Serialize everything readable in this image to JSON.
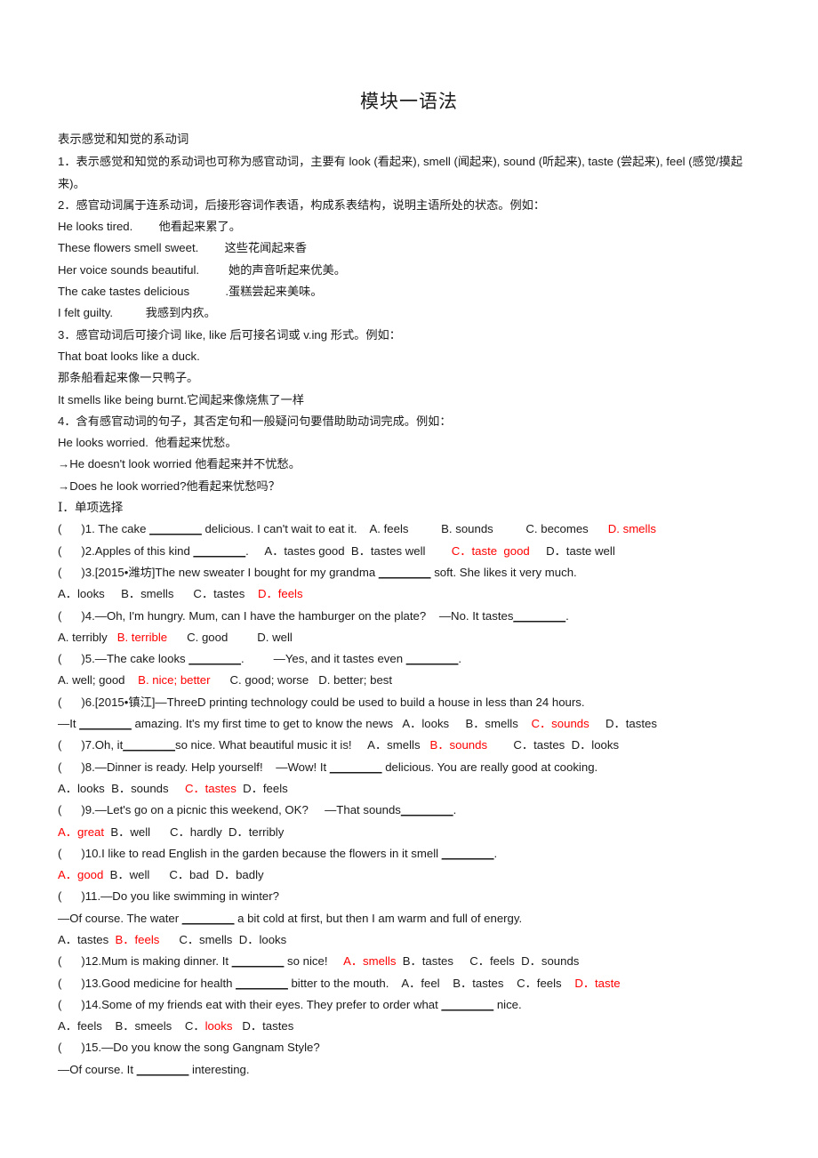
{
  "document": {
    "title": "模块一语法",
    "accent_color": "#ff0000",
    "text_color": "#1a1a1a",
    "background": "#ffffff"
  },
  "grammar": {
    "heading": "表示感觉和知觉的系动词",
    "point1": "1．表示感觉和知觉的系动词也可称为感官动词，主要有 look (看起来), smell (闻起来), sound (听起来), taste (尝起来), feel (感觉/摸起来)。",
    "point2": "2．感官动词属于连系动词，后接形容词作表语，构成系表结构，说明主语所处的状态。例如：",
    "examples2": [
      "He looks tired.        他看起来累了。",
      "These flowers smell sweet.        这些花闻起来香",
      "Her voice sounds beautiful.         她的声音听起来优美。",
      "The cake tastes delicious           .蛋糕尝起来美味。",
      "I felt guilty.          我感到内疚。"
    ],
    "point3": "3．感官动词后可接介词 like, like 后可接名词或 v.ing 形式。例如：",
    "examples3": [
      "That boat looks like a duck.",
      "那条船看起来像一只鸭子。",
      "It smells like being burnt.它闻起来像烧焦了一样"
    ],
    "point4": "4．含有感官动词的句子，其否定句和一般疑问句要借助助动词完成。例如：",
    "examples4": [
      "He looks worried.  他看起来忧愁。",
      "→He doesn't look worried 他看起来并不忧愁。",
      "→Does he look worried?他看起来忧愁吗？"
    ]
  },
  "section1": {
    "heading": "Ⅰ．单项选择",
    "questions": [
      {
        "id": "q1",
        "lines": [
          [
            {
              "t": "(      )1. The cake ",
              "red": false
            },
            {
              "t": "________",
              "red": false,
              "blank": true
            },
            {
              "t": " delicious. I can't wait to eat it.    A. feels          B. sounds          C. becomes      ",
              "red": false
            },
            {
              "t": "D. smells",
              "red": true
            }
          ]
        ]
      },
      {
        "id": "q2",
        "lines": [
          [
            {
              "t": "(      )2.Apples of this kind ",
              "red": false
            },
            {
              "t": "________",
              "red": false,
              "blank": true
            },
            {
              "t": ".     A．tastes good  B．tastes well        ",
              "red": false
            },
            {
              "t": "C．taste  good",
              "red": true
            },
            {
              "t": "     D．taste well",
              "red": false
            }
          ]
        ]
      },
      {
        "id": "q3",
        "lines": [
          [
            {
              "t": "(      )3.[2015•潍坊]The new sweater I bought for my grandma ",
              "red": false
            },
            {
              "t": "________",
              "red": false,
              "blank": true
            },
            {
              "t": " soft. She likes it very much.",
              "red": false
            }
          ],
          [
            {
              "t": "A．looks     B．smells      C．tastes    ",
              "red": false
            },
            {
              "t": "D．feels",
              "red": true
            }
          ]
        ]
      },
      {
        "id": "q4",
        "lines": [
          [
            {
              "t": "(      )4.—Oh, I'm hungry. Mum, can I have the hamburger on the plate?    —No. It tastes",
              "red": false
            },
            {
              "t": "________",
              "red": false,
              "blank": true
            },
            {
              "t": ".",
              "red": false
            }
          ],
          [
            {
              "t": "A. terribly   ",
              "red": false
            },
            {
              "t": "B. terrible",
              "red": true
            },
            {
              "t": "      C. good         D. well",
              "red": false
            }
          ]
        ]
      },
      {
        "id": "q5",
        "lines": [
          [
            {
              "t": "(      )5.—The cake looks ",
              "red": false
            },
            {
              "t": "________",
              "red": false,
              "blank": true
            },
            {
              "t": ".         —Yes, and it tastes even ",
              "red": false
            },
            {
              "t": "________",
              "red": false,
              "blank": true
            },
            {
              "t": ".",
              "red": false
            }
          ],
          [
            {
              "t": "A. well; good    ",
              "red": false
            },
            {
              "t": "B. nice; better",
              "red": true
            },
            {
              "t": "      C. good; worse   D. better; best",
              "red": false
            }
          ]
        ]
      },
      {
        "id": "q6",
        "lines": [
          [
            {
              "t": "(      )6.[2015•镇江]—ThreeD printing technology could be used to build a house in less than 24 hours.",
              "red": false
            }
          ],
          [
            {
              "t": "—It ",
              "red": false
            },
            {
              "t": "________",
              "red": false,
              "blank": true
            },
            {
              "t": " amazing. It's my first time to get to know the news   A．looks     B．smells    ",
              "red": false
            },
            {
              "t": "C．sounds",
              "red": true
            },
            {
              "t": "     D．tastes",
              "red": false
            }
          ]
        ]
      },
      {
        "id": "q7",
        "lines": [
          [
            {
              "t": "(      )7.Oh, it",
              "red": false
            },
            {
              "t": "________",
              "red": false,
              "blank": true
            },
            {
              "t": "so nice. What beautiful music it is!     A．smells   ",
              "red": false
            },
            {
              "t": "B．sounds",
              "red": true
            },
            {
              "t": "        C．tastes  D．looks",
              "red": false
            }
          ]
        ]
      },
      {
        "id": "q8",
        "lines": [
          [
            {
              "t": "(      )8.—Dinner is ready. Help yourself!    —Wow! It ",
              "red": false
            },
            {
              "t": "________",
              "red": false,
              "blank": true
            },
            {
              "t": " delicious. You are really good at cooking.",
              "red": false
            }
          ],
          [
            {
              "t": "A．looks  B．sounds     ",
              "red": false
            },
            {
              "t": "C．tastes",
              "red": true
            },
            {
              "t": "  D．feels",
              "red": false
            }
          ]
        ]
      },
      {
        "id": "q9",
        "lines": [
          [
            {
              "t": "(      )9.—Let's go on a picnic this weekend, OK?     —That sounds",
              "red": false
            },
            {
              "t": "________",
              "red": false,
              "blank": true
            },
            {
              "t": ".",
              "red": false
            }
          ],
          [
            {
              "t": "A．great",
              "red": true
            },
            {
              "t": "  B．well      C．hardly  D．terribly",
              "red": false
            }
          ]
        ]
      },
      {
        "id": "q10",
        "lines": [
          [
            {
              "t": "(      )10.I like to read English in the garden because the flowers in it smell ",
              "red": false
            },
            {
              "t": "________",
              "red": false,
              "blank": true
            },
            {
              "t": ".",
              "red": false
            }
          ],
          [
            {
              "t": "A．good",
              "red": true
            },
            {
              "t": "  B．well      C．bad  D．badly",
              "red": false
            }
          ]
        ]
      },
      {
        "id": "q11",
        "lines": [
          [
            {
              "t": "(      )11.—Do you like swimming in winter?",
              "red": false
            }
          ],
          [
            {
              "t": "—Of course. The water ",
              "red": false
            },
            {
              "t": "________",
              "red": false,
              "blank": true
            },
            {
              "t": " a bit cold at first, but then I am warm and full of energy.",
              "red": false
            }
          ],
          [
            {
              "t": "A．tastes  ",
              "red": false
            },
            {
              "t": "B．feels",
              "red": true
            },
            {
              "t": "      C．smells  D．looks",
              "red": false
            }
          ]
        ]
      },
      {
        "id": "q12",
        "lines": [
          [
            {
              "t": "(      )12.Mum is making dinner. It ",
              "red": false
            },
            {
              "t": "________",
              "red": false,
              "blank": true
            },
            {
              "t": " so nice!     ",
              "red": false
            },
            {
              "t": "A．smells",
              "red": true
            },
            {
              "t": "  B．tastes     C．feels  D．sounds",
              "red": false
            }
          ]
        ]
      },
      {
        "id": "q13",
        "lines": [
          [
            {
              "t": "(      )13.Good medicine for health ",
              "red": false
            },
            {
              "t": "________",
              "red": false,
              "blank": true
            },
            {
              "t": " bitter to the mouth.    A．feel    B．tastes    C．feels    ",
              "red": false
            },
            {
              "t": "D．taste",
              "red": true
            }
          ]
        ]
      },
      {
        "id": "q14",
        "lines": [
          [
            {
              "t": "(      )14.Some of my friends eat with their eyes. They prefer to order what ",
              "red": false
            },
            {
              "t": "________",
              "red": false,
              "blank": true
            },
            {
              "t": " nice.",
              "red": false
            }
          ],
          [
            {
              "t": "A．feels    B．smeels    C．",
              "red": false
            },
            {
              "t": "looks",
              "red": true
            },
            {
              "t": "   D．tastes",
              "red": false
            }
          ]
        ]
      },
      {
        "id": "q15",
        "lines": [
          [
            {
              "t": "(      )15.—Do you know the song Gangnam Style?",
              "red": false
            }
          ],
          [
            {
              "t": "—Of course. It ",
              "red": false
            },
            {
              "t": "________",
              "red": false,
              "blank": true
            },
            {
              "t": " interesting.",
              "red": false
            }
          ]
        ]
      }
    ]
  }
}
